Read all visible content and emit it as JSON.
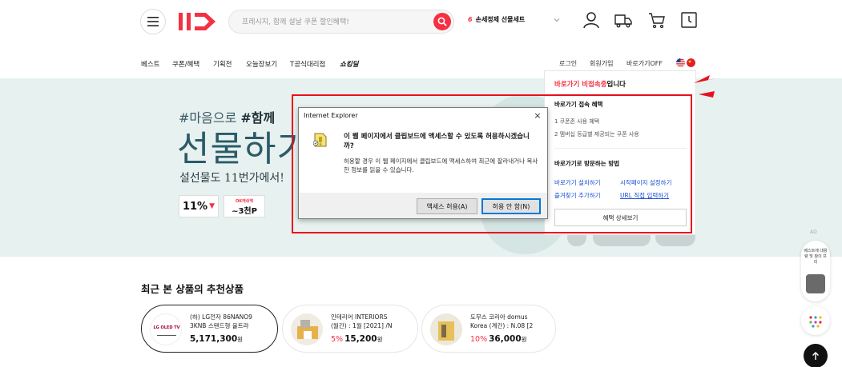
{
  "header": {
    "search_placeholder": "프레시지, 함께 설날 쿠폰 할인혜택!",
    "keyword_rank": "6",
    "keyword_text": "손세정제 선물세트"
  },
  "nav": {
    "items": [
      "베스트",
      "쿠폰/혜택",
      "기획전",
      "오늘장보기",
      "T공식대리점"
    ],
    "shocking_prefix": "쇼킹딜",
    "login": "로그인",
    "signup": "회원가입",
    "bookmark": "바로가기OFF"
  },
  "banner": {
    "sub_prefix": "#마음으로 ",
    "sub_bold": "#함께",
    "title": "선물하기",
    "desc": "설선물도 11번가에서!",
    "badge1": "11%",
    "badge2_tag": "OK캐쉬백",
    "badge2_points": "~3천P"
  },
  "dialog": {
    "title": "Internet Explorer",
    "close": "×",
    "question": "이 웹 페이지에서 클립보드에 액세스할 수 있도록 허용하시겠습니까?",
    "message": "허용할 경우 이 웹 페이지에서 클립보드에 액세스하여 최근에 잘라내거나 복사한 정보를 읽을 수 있습니다.",
    "allow_button": "액세스 허용(A)",
    "deny_button": "허용 안 함(N)"
  },
  "bookmark_panel": {
    "head_red": "바로가기 비접속중",
    "head_rest": "입니다",
    "benefit_title": "바로가기 접속 혜택",
    "benefit_1": "1 쿠폰존 사용 혜택",
    "benefit_2": "2 멤버십 등급별 제공되는 쿠폰 사용",
    "method_title": "바로가기로 방문하는 방법",
    "link_install": "바로가기 설치하기",
    "link_homepage": "시작페이지 설정하기",
    "link_favorite": "즐겨찾기 추가하기",
    "link_url": "URL 직접 입력하기",
    "detail_button": "혜택 상세보기"
  },
  "recent": {
    "title": "최근 본 상품의 추천상품",
    "products": [
      {
        "name1": "(하) LG전자 86NANO9",
        "name2": "3KNB 스탠드형 울트라",
        "discount": "",
        "price": "5,171,300",
        "won": "원",
        "thumb_label": "LG OLED TV"
      },
      {
        "name1": "인테리어 INTERIORS",
        "name2": "(월간) : 1월 [2021] /N",
        "discount": "5%",
        "price": "15,200",
        "won": "원",
        "thumb_label": ""
      },
      {
        "name1": "도무스 코리아 domus",
        "name2": "Korea (계간) : N.08 [2",
        "discount": "10%",
        "price": "36,000",
        "won": "원",
        "thumb_label": ""
      }
    ]
  },
  "side": {
    "label": "AD",
    "text": "베스트에 대용량 및 참이 프리"
  },
  "colors": {
    "brand_red": "#f43142",
    "banner_bg": "#e7f1ef",
    "highlight_red": "#e8101e",
    "link_blue": "#1a4fd6"
  }
}
